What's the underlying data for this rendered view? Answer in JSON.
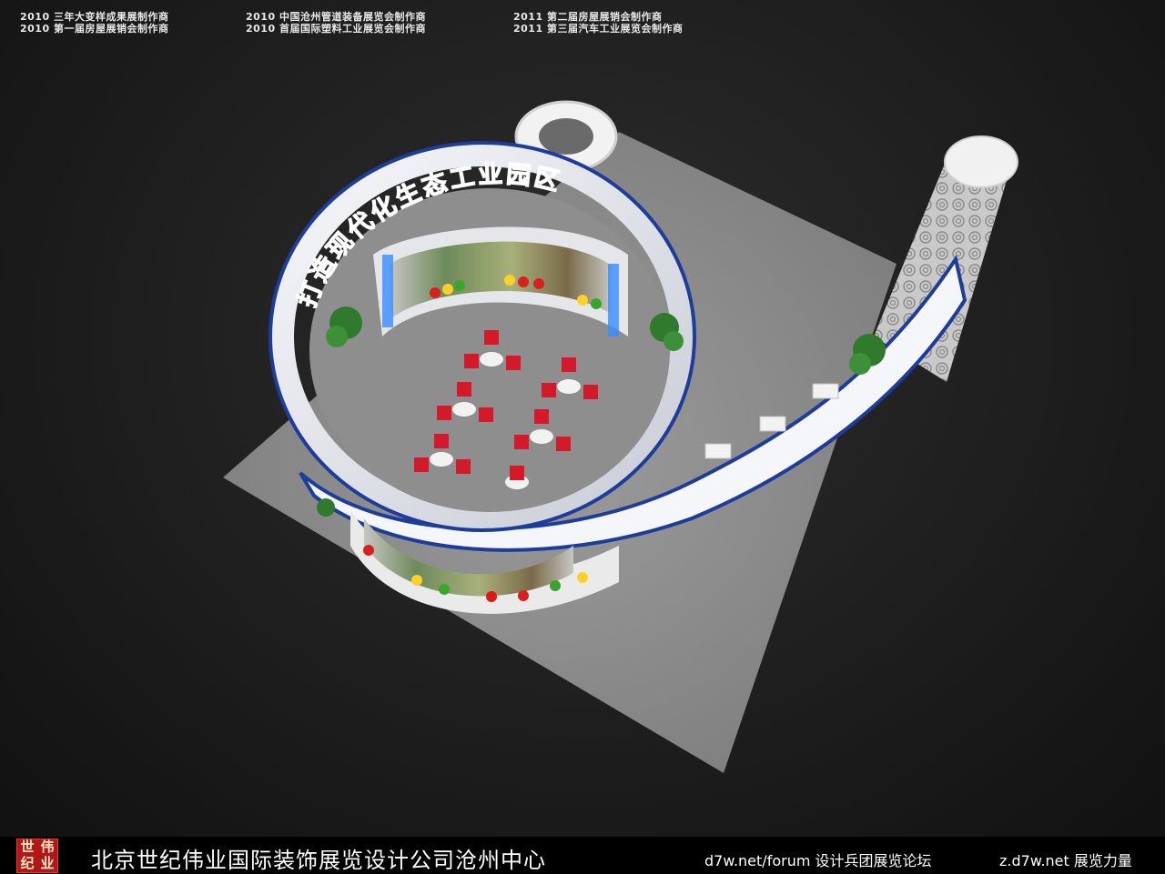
{
  "credits": [
    "2010 三年大变样成果展制作商",
    "2010 第一届房屋展销会制作商",
    "2010 中国沧州管道装备展览会制作商",
    "2010 首届国际塑料工业展览会制作商",
    "2011 第二届房屋展销会制作商",
    "2011 第三届汽车工业展览会制作商"
  ],
  "banner": "打造现代化生态工业园区",
  "footer": {
    "logo_chars": [
      "世",
      "伟",
      "纪",
      "业"
    ],
    "company": "北京世纪伟业国际装饰展览设计公司沧州中心",
    "forum_1": "d7w.net/forum 设计兵团展览论坛",
    "forum_2": "z.d7w.net 展览力量"
  },
  "colors": {
    "floor": "#8f8f8f",
    "ring_white": "#eef0f4",
    "ring_blue": "#1e3c9a",
    "banner_red": "#e01818",
    "chair_red": "#d41a2a",
    "plant_green": "#2f7a2c",
    "led_blue": "#3a8cff"
  }
}
